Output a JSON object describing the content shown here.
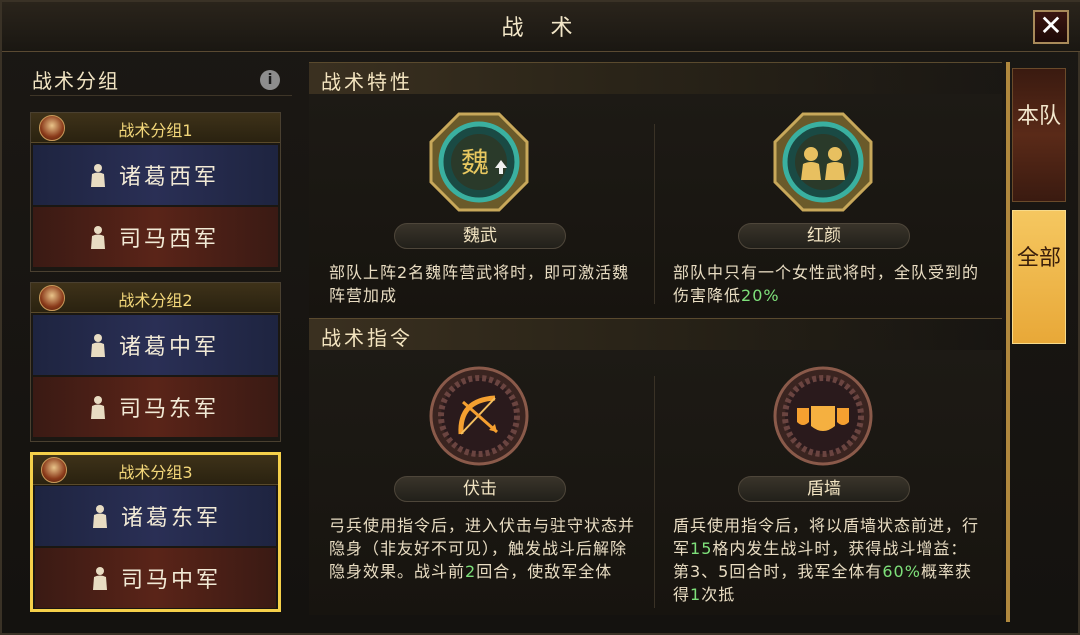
{
  "window": {
    "title": "战 术"
  },
  "left": {
    "title": "战术分组",
    "groups": [
      {
        "name": "战术分组1",
        "armies": [
          "诸葛西军",
          "司马西军"
        ],
        "selected": false
      },
      {
        "name": "战术分组2",
        "armies": [
          "诸葛中军",
          "司马东军"
        ],
        "selected": false
      },
      {
        "name": "战术分组3",
        "armies": [
          "诸葛东军",
          "司马中军"
        ],
        "selected": true
      }
    ]
  },
  "traits": {
    "title": "战术特性",
    "items": [
      {
        "icon": "wei-faction-icon",
        "name": "魏武",
        "desc": "部队上阵2名魏阵营武将时，即可激活魏阵营加成"
      },
      {
        "icon": "two-women-portrait-icon",
        "name": "红颜",
        "desc_pre": "部队中只有一个女性武将时，全队受到的伤害降低",
        "desc_hl": "20%"
      }
    ]
  },
  "commands": {
    "title": "战术指令",
    "items": [
      {
        "icon": "bow-icon",
        "name": "伏击",
        "desc_parts": [
          "弓兵使用指令后，进入伏击与驻守状态并隐身（非友好不可见），触发战斗后解除隐身效果。战斗前",
          "2",
          "回合，使敌军全体"
        ]
      },
      {
        "icon": "shield-wall-icon",
        "name": "盾墙",
        "desc_parts": [
          "盾兵使用指令后，将以盾墙状态前进，行军",
          "15",
          "格内发生战斗时，获得战斗增益：第3、5回合时，我军全体有",
          "60%",
          "概率获得",
          "1",
          "次抵"
        ]
      }
    ]
  },
  "tabs": [
    {
      "label": "本队",
      "active": false
    },
    {
      "label": "全部",
      "active": true
    }
  ],
  "colors": {
    "highlight": "#7ee07a",
    "selected_border": "#f5d04a",
    "tab_active": "#f0b848"
  }
}
